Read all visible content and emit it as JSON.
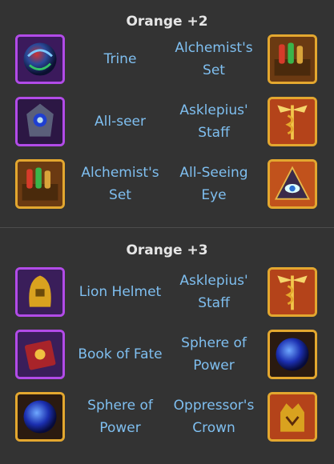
{
  "sections": [
    {
      "title": "Orange +2",
      "rows": [
        {
          "left_icon": "trine-orb-icon",
          "left_label": "Trine",
          "right_label": "Alchemist's Set",
          "right_icon": "alchemist-set-icon"
        },
        {
          "left_icon": "all-seer-icon",
          "left_label": "All-seer",
          "right_label": "Asklepius' Staff",
          "right_icon": "asklepius-staff-icon"
        },
        {
          "left_icon": "alchemist-set-icon",
          "left_label": "Alchemist's Set",
          "right_label": "All-Seeing Eye",
          "right_icon": "all-seeing-eye-icon"
        }
      ]
    },
    {
      "title": "Orange +3",
      "rows": [
        {
          "left_icon": "lion-helmet-icon",
          "left_label": "Lion Helmet",
          "right_label": "Asklepius' Staff",
          "right_icon": "asklepius-staff-icon"
        },
        {
          "left_icon": "book-of-fate-icon",
          "left_label": "Book of Fate",
          "right_label": "Sphere of Power",
          "right_icon": "sphere-of-power-icon"
        },
        {
          "left_icon": "sphere-of-power-icon",
          "left_label": "Sphere of Power",
          "right_label": "Oppressor's Crown",
          "right_icon": "oppressors-crown-icon"
        }
      ]
    }
  ],
  "colors": {
    "background": "#333333",
    "label": "#7fbff0",
    "title": "#e6e6e6",
    "purple_frame": "#b24be8",
    "gold_frame": "#e3a72f"
  }
}
